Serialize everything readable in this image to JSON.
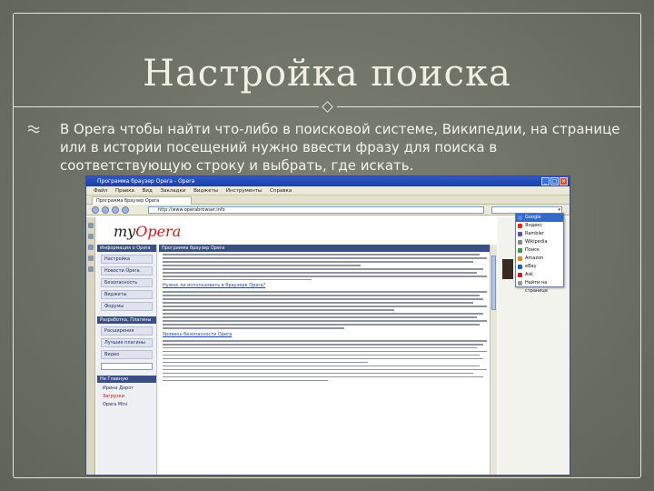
{
  "slide": {
    "title": "Настройка поиска",
    "bullet_text": "В Opera чтобы найти что-либо в поисковой системе, Википедии, на странице или в истории посещений нужно ввести фразу для поиска в соответствующую строку и выбрать, где искать."
  },
  "screenshot": {
    "window_title": "Программа браузер Opera - Opera",
    "menu": [
      "Файл",
      "Правка",
      "Вид",
      "Закладки",
      "Виджеты",
      "Инструменты",
      "Справка"
    ],
    "tab_label": "Программа браузер Opera",
    "address": "http://www.operabrowser.info",
    "logo_prefix": "my",
    "logo_brand": "Opera",
    "left_header": "Информация о Opera",
    "left_items": [
      "Настройка",
      "Новости Opera",
      "Безопасность",
      "Виджеты",
      "Форумы"
    ],
    "left_header_2": "Разработка, Плагины",
    "left_items_2": [
      "Расширения",
      "Лучшие плагины",
      "Видео"
    ],
    "left_header_3": "На Главную",
    "left_links": [
      "Ирина Дорот",
      "Загрузки",
      "Opera Mini"
    ],
    "center_header": "Программа браузер Opera",
    "center_subheads": [
      "Нужно ли использовать в браузере Opera?",
      "Уровень безопасности Opera"
    ],
    "dropdown_items": [
      "Google",
      "Яндекс",
      "Rambler",
      "Wikipedia",
      "Поиск",
      "Amazon",
      "eBay",
      "Ask",
      "Найти на странице"
    ],
    "dropdown_selected": "Google",
    "search_go": "▾"
  },
  "colors": {
    "slide_bg": "#6e7266",
    "title_text": "#f1efe2",
    "window_titlebar": "#1a3fa8",
    "panel_header": "#3a4f84",
    "logo_accent": "#cc1a1a"
  }
}
